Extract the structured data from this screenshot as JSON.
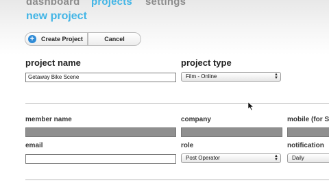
{
  "nav": {
    "items": [
      "dashboard",
      "projects",
      "settings"
    ]
  },
  "page": {
    "title": "new project"
  },
  "toolbar": {
    "create_label": "Create Project",
    "cancel_label": "Cancel"
  },
  "project": {
    "name_label": "project name",
    "name_value": "Getaway Bike Scene",
    "type_label": "project type",
    "type_value": "Film - Online"
  },
  "member": {
    "name_label": "member name",
    "company_label": "company",
    "mobile_label": "mobile (for S",
    "email_label": "email",
    "role_label": "role",
    "role_value": "Post Operator",
    "notification_label": "notification",
    "notification_value": "Daily"
  },
  "colors": {
    "accent": "#42b5e6",
    "nav_inactive": "#8c8c8c",
    "add_icon": "#2f8bd6"
  }
}
